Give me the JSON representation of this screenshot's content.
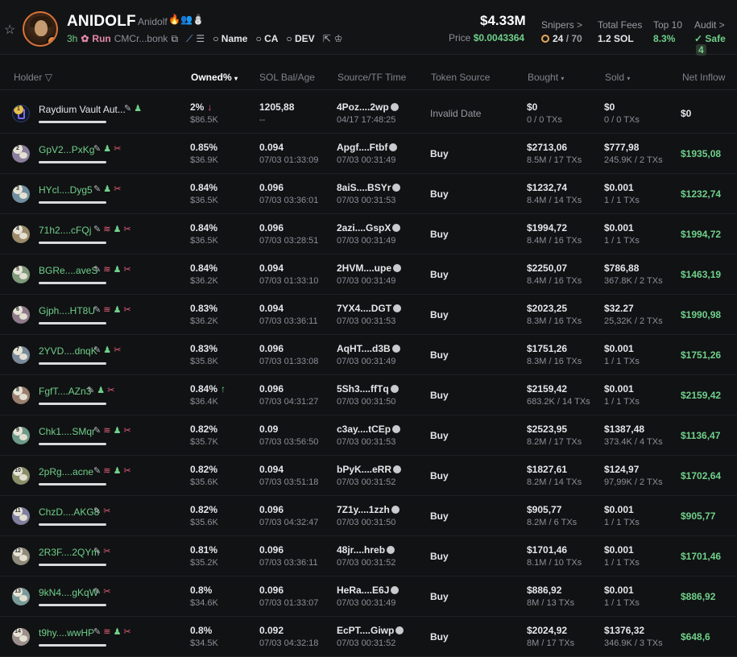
{
  "token": {
    "name": "ANIDOLF",
    "subname": "Anidolf",
    "age": "3h",
    "run_label": "Run",
    "market_addr": "CMCr...bonk",
    "search_links": [
      "Name",
      "CA",
      "DEV"
    ]
  },
  "market": {
    "mcap": "$4.33M",
    "price_label": "Price",
    "price": "$0.0043364"
  },
  "stats": {
    "snipers_label": "Snipers >",
    "snipers_value": "24",
    "snipers_total": "/ 70",
    "fees_label": "Total Fees",
    "fees_value": "1.2 SOL",
    "top10_label": "Top 10",
    "top10_value": "8.3%",
    "audit_label": "Audit >",
    "audit_value": "Safe",
    "audit_count": "4"
  },
  "colors": {
    "accent_green": "#6fd08a",
    "accent_red": "#e8627a",
    "background": "#111214"
  },
  "table": {
    "headers": {
      "holder": "Holder",
      "owned": "Owned%",
      "sol_bal": "SOL Bal/Age",
      "source_tf": "Source/TF Time",
      "token_source": "Token Source",
      "bought": "Bought",
      "sold": "Sold",
      "net_inflow": "Net Inflow"
    },
    "rows": [
      {
        "rank": "1",
        "holder": "Raydium Vault Aut...",
        "owned": "2%",
        "owned_usd": "$86.5K",
        "sol": "1205,88",
        "age": "--",
        "source": "4Poz....2wp",
        "tf_time": "04/17 17:48:25",
        "token_source": "Invalid Date",
        "bought": "$0",
        "bought_txs": "0 / 0 TXs",
        "sold": "$0",
        "sold_txs": "0 / 0 TXs",
        "net": "$0"
      },
      {
        "rank": "2",
        "holder": "GpV2...PxKg",
        "owned": "0.85%",
        "owned_usd": "$36.9K",
        "sol": "0.094",
        "age": "07/03 01:33:09",
        "source": "Apgf....Ftbf",
        "tf_time": "07/03 00:31:49",
        "token_source": "Buy",
        "bought": "$2713,06",
        "bought_txs": "8.5M / 17 TXs",
        "sold": "$777,98",
        "sold_txs": "245.9K / 2 TXs",
        "net": "$1935,08"
      },
      {
        "rank": "3",
        "holder": "HYcl....Dyg5",
        "owned": "0.84%",
        "owned_usd": "$36.5K",
        "sol": "0.096",
        "age": "07/03 03:36:01",
        "source": "8aiS....BSYr",
        "tf_time": "07/03 00:31:53",
        "token_source": "Buy",
        "bought": "$1232,74",
        "bought_txs": "8.4M / 14 TXs",
        "sold": "$0.001",
        "sold_txs": "1 / 1 TXs",
        "net": "$1232,74"
      },
      {
        "rank": "4",
        "holder": "71h2....cFQj",
        "owned": "0.84%",
        "owned_usd": "$36.5K",
        "sol": "0.096",
        "age": "07/03 03:28:51",
        "source": "2azi....GspX",
        "tf_time": "07/03 00:31:49",
        "token_source": "Buy",
        "bought": "$1994,72",
        "bought_txs": "8.4M / 16 TXs",
        "sold": "$0.001",
        "sold_txs": "1 / 1 TXs",
        "net": "$1994,72"
      },
      {
        "rank": "5",
        "holder": "BGRe....aveS",
        "owned": "0.84%",
        "owned_usd": "$36.2K",
        "sol": "0.094",
        "age": "07/03 01:33:10",
        "source": "2HVM....upe",
        "tf_time": "07/03 00:31:49",
        "token_source": "Buy",
        "bought": "$2250,07",
        "bought_txs": "8.4M / 16 TXs",
        "sold": "$786,88",
        "sold_txs": "367.8K / 2 TXs",
        "net": "$1463,19"
      },
      {
        "rank": "6",
        "holder": "Gjph....HT8U",
        "owned": "0.83%",
        "owned_usd": "$36.2K",
        "sol": "0.094",
        "age": "07/03 03:36:11",
        "source": "7YX4....DGT",
        "tf_time": "07/03 00:31:53",
        "token_source": "Buy",
        "bought": "$2023,25",
        "bought_txs": "8.3M / 16 TXs",
        "sold": "$32.27",
        "sold_txs": "25,32K / 2 TXs",
        "net": "$1990,98"
      },
      {
        "rank": "7",
        "holder": "2YVD....dnqK",
        "owned": "0.83%",
        "owned_usd": "$35.8K",
        "sol": "0.096",
        "age": "07/03 01:33:08",
        "source": "AqHT....d3B",
        "tf_time": "07/03 00:31:49",
        "token_source": "Buy",
        "bought": "$1751,26",
        "bought_txs": "8.3M / 16 TXs",
        "sold": "$0.001",
        "sold_txs": "1 / 1 TXs",
        "net": "$1751,26"
      },
      {
        "rank": "8",
        "holder": "FgfT....AZn3",
        "owned": "0.84%",
        "owned_usd": "$36.4K",
        "sol": "0.096",
        "age": "07/03 04:31:27",
        "source": "5Sh3....ffTq",
        "tf_time": "07/03 00:31:50",
        "token_source": "Buy",
        "bought": "$2159,42",
        "bought_txs": "683.2K / 14 TXs",
        "sold": "$0.001",
        "sold_txs": "1 / 1 TXs",
        "net": "$2159,42"
      },
      {
        "rank": "9",
        "holder": "Chk1....SMqr",
        "owned": "0.82%",
        "owned_usd": "$35.7K",
        "sol": "0.09",
        "age": "07/03 03:56:50",
        "source": "c3ay....tCEp",
        "tf_time": "07/03 00:31:53",
        "token_source": "Buy",
        "bought": "$2523,95",
        "bought_txs": "8.2M / 17 TXs",
        "sold": "$1387,48",
        "sold_txs": "373.4K / 4 TXs",
        "net": "$1136,47"
      },
      {
        "rank": "10",
        "holder": "2pRg....acne",
        "owned": "0.82%",
        "owned_usd": "$35.6K",
        "sol": "0.094",
        "age": "07/03 03:51:18",
        "source": "bPyK....eRR",
        "tf_time": "07/03 00:31:52",
        "token_source": "Buy",
        "bought": "$1827,61",
        "bought_txs": "8.2M / 14 TXs",
        "sold": "$124,97",
        "sold_txs": "97,99K / 2 TXs",
        "net": "$1702,64"
      },
      {
        "rank": "11",
        "holder": "ChzD....AKG8",
        "owned": "0.82%",
        "owned_usd": "$35.6K",
        "sol": "0.096",
        "age": "07/03 04:32:47",
        "source": "7Z1y....1zzh",
        "tf_time": "07/03 00:31:50",
        "token_source": "Buy",
        "bought": "$905,77",
        "bought_txs": "8.2M / 6 TXs",
        "sold": "$0.001",
        "sold_txs": "1 / 1 TXs",
        "net": "$905,77"
      },
      {
        "rank": "12",
        "holder": "2R3F....2QYm",
        "owned": "0.81%",
        "owned_usd": "$35.2K",
        "sol": "0.096",
        "age": "07/03 03:36:11",
        "source": "48jr....hreb",
        "tf_time": "07/03 00:31:52",
        "token_source": "Buy",
        "bought": "$1701,46",
        "bought_txs": "8.1M / 10 TXs",
        "sold": "$0.001",
        "sold_txs": "1 / 1 TXs",
        "net": "$1701,46"
      },
      {
        "rank": "13",
        "holder": "9kN4....gKqW",
        "owned": "0.8%",
        "owned_usd": "$34.6K",
        "sol": "0.096",
        "age": "07/03 01:33:07",
        "source": "HeRa....E6J",
        "tf_time": "07/03 00:31:49",
        "token_source": "Buy",
        "bought": "$886,92",
        "bought_txs": "8M / 13 TXs",
        "sold": "$0.001",
        "sold_txs": "1 / 1 TXs",
        "net": "$886,92"
      },
      {
        "rank": "14",
        "holder": "t9hy....wwHP",
        "owned": "0.8%",
        "owned_usd": "$34.5K",
        "sol": "0.092",
        "age": "07/03 04:32:18",
        "source": "EcPT....Giwp",
        "tf_time": "07/03 00:31:52",
        "token_source": "Buy",
        "bought": "$2024,92",
        "bought_txs": "8M / 17 TXs",
        "sold": "$1376,32",
        "sold_txs": "346.9K / 3 TXs",
        "net": "$648,6"
      }
    ]
  }
}
